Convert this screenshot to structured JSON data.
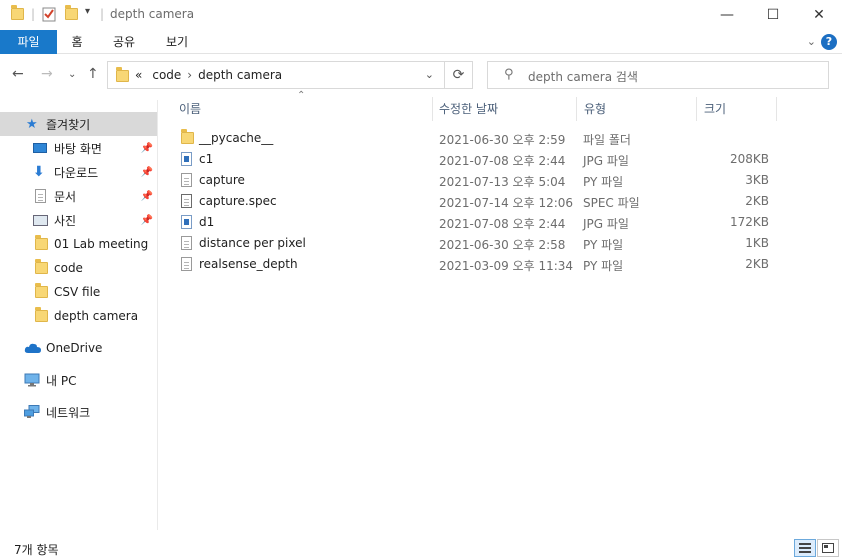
{
  "window": {
    "title": "depth camera",
    "minimize_glyph": "—",
    "maximize_glyph": "☐",
    "close_glyph": "✕"
  },
  "ribbon": {
    "tabs": [
      {
        "label": "파일"
      },
      {
        "label": "홈"
      },
      {
        "label": "공유"
      },
      {
        "label": "보기"
      }
    ],
    "help": "?"
  },
  "address": {
    "overflow": "«",
    "crumbs": [
      "code",
      "depth camera"
    ],
    "separator": "›"
  },
  "search": {
    "placeholder": "depth camera 검색"
  },
  "nav_pane": {
    "items": [
      {
        "label": "즐겨찾기",
        "icon": "star-icon",
        "pinned": false
      },
      {
        "label": "바탕 화면",
        "icon": "desktop-icon",
        "pinned": true
      },
      {
        "label": "다운로드",
        "icon": "download-icon",
        "pinned": true
      },
      {
        "label": "문서",
        "icon": "document-icon",
        "pinned": true
      },
      {
        "label": "사진",
        "icon": "picture-icon",
        "pinned": true
      },
      {
        "label": "01 Lab meeting",
        "icon": "folder-icon",
        "pinned": false
      },
      {
        "label": "code",
        "icon": "folder-icon",
        "pinned": false
      },
      {
        "label": "CSV file",
        "icon": "folder-icon",
        "pinned": false
      },
      {
        "label": "depth camera",
        "icon": "folder-icon",
        "pinned": false
      },
      {
        "label": "OneDrive",
        "icon": "cloud-icon",
        "pinned": false
      },
      {
        "label": "내 PC",
        "icon": "pc-icon",
        "pinned": false
      },
      {
        "label": "네트워크",
        "icon": "network-icon",
        "pinned": false
      }
    ]
  },
  "columns": {
    "name": "이름",
    "modified": "수정한 날짜",
    "type": "유형",
    "size": "크기"
  },
  "files": [
    {
      "name": "__pycache__",
      "modified": "2021-06-30 오후 2:59",
      "type": "파일 폴더",
      "size": "",
      "icon": "folder-icon"
    },
    {
      "name": "c1",
      "modified": "2021-07-08 오후 2:44",
      "type": "JPG 파일",
      "size": "208KB",
      "icon": "jpg-file-icon"
    },
    {
      "name": "capture",
      "modified": "2021-07-13 오후 5:04",
      "type": "PY 파일",
      "size": "3KB",
      "icon": "py-file-icon"
    },
    {
      "name": "capture.spec",
      "modified": "2021-07-14 오후 12:06",
      "type": "SPEC 파일",
      "size": "2KB",
      "icon": "spec-file-icon"
    },
    {
      "name": "d1",
      "modified": "2021-07-08 오후 2:44",
      "type": "JPG 파일",
      "size": "172KB",
      "icon": "jpg-file-icon"
    },
    {
      "name": "distance per pixel",
      "modified": "2021-06-30 오후 2:58",
      "type": "PY 파일",
      "size": "1KB",
      "icon": "py-file-icon"
    },
    {
      "name": "realsense_depth",
      "modified": "2021-03-09 오후 11:34",
      "type": "PY 파일",
      "size": "2KB",
      "icon": "py-file-icon"
    }
  ],
  "status": {
    "item_count": "7개 항목"
  }
}
